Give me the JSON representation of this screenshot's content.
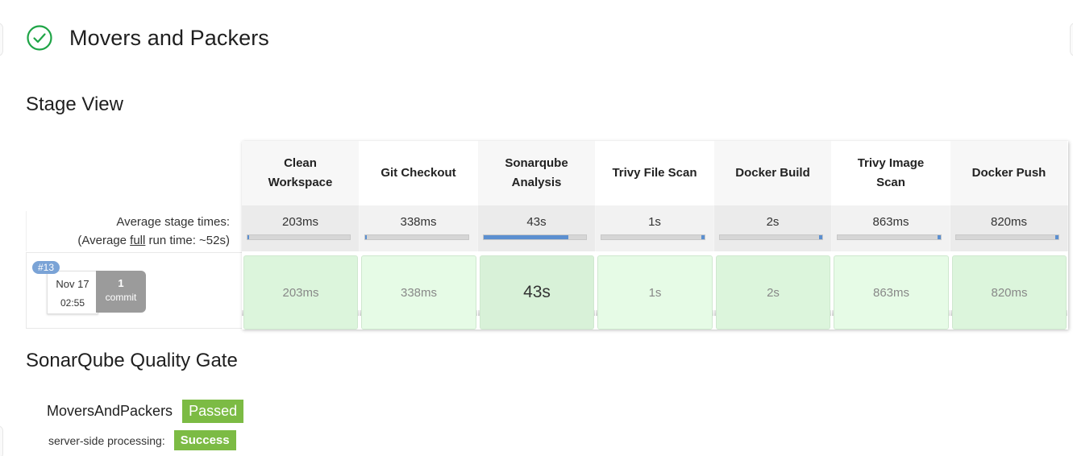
{
  "job": {
    "title": "Movers and Packers",
    "status_icon": "check-circle-icon",
    "status_color": "#1ea446"
  },
  "stage_view": {
    "title": "Stage View",
    "avg_label_line1": "Average stage times:",
    "avg_label_prefix": "(Average ",
    "avg_label_full": "full",
    "avg_label_suffix": " run time: ~52s)",
    "stages": [
      {
        "name_line1": "Clean",
        "name_line2": "Workspace",
        "avg": "203ms",
        "run": "203ms",
        "progress_fraction": 0.004
      },
      {
        "name_line1": "Git Checkout",
        "name_line2": "",
        "avg": "338ms",
        "run": "338ms",
        "progress_fraction": 0.007
      },
      {
        "name_line1": "Sonarqube",
        "name_line2": "Analysis",
        "avg": "43s",
        "run": "43s",
        "progress_fraction": 0.83
      },
      {
        "name_line1": "Trivy File Scan",
        "name_line2": "",
        "avg": "1s",
        "run": "1s",
        "progress_fraction": 0.02
      },
      {
        "name_line1": "Docker Build",
        "name_line2": "",
        "avg": "2s",
        "run": "2s",
        "progress_fraction": 0.04
      },
      {
        "name_line1": "Trivy Image",
        "name_line2": "Scan",
        "avg": "863ms",
        "run": "863ms",
        "progress_fraction": 0.017
      },
      {
        "name_line1": "Docker Push",
        "name_line2": "",
        "avg": "820ms",
        "run": "820ms",
        "progress_fraction": 0.016
      }
    ],
    "build": {
      "number": "#13",
      "date": "Nov 17",
      "time": "02:55",
      "commit_count": "1",
      "commit_label": "commit"
    }
  },
  "quality_gate": {
    "title": "SonarQube Quality Gate",
    "project": "MoversAndPackers",
    "status": "Passed",
    "processing_label": "server-side processing:",
    "processing_status": "Success",
    "status_color": "#7cbb44"
  }
}
